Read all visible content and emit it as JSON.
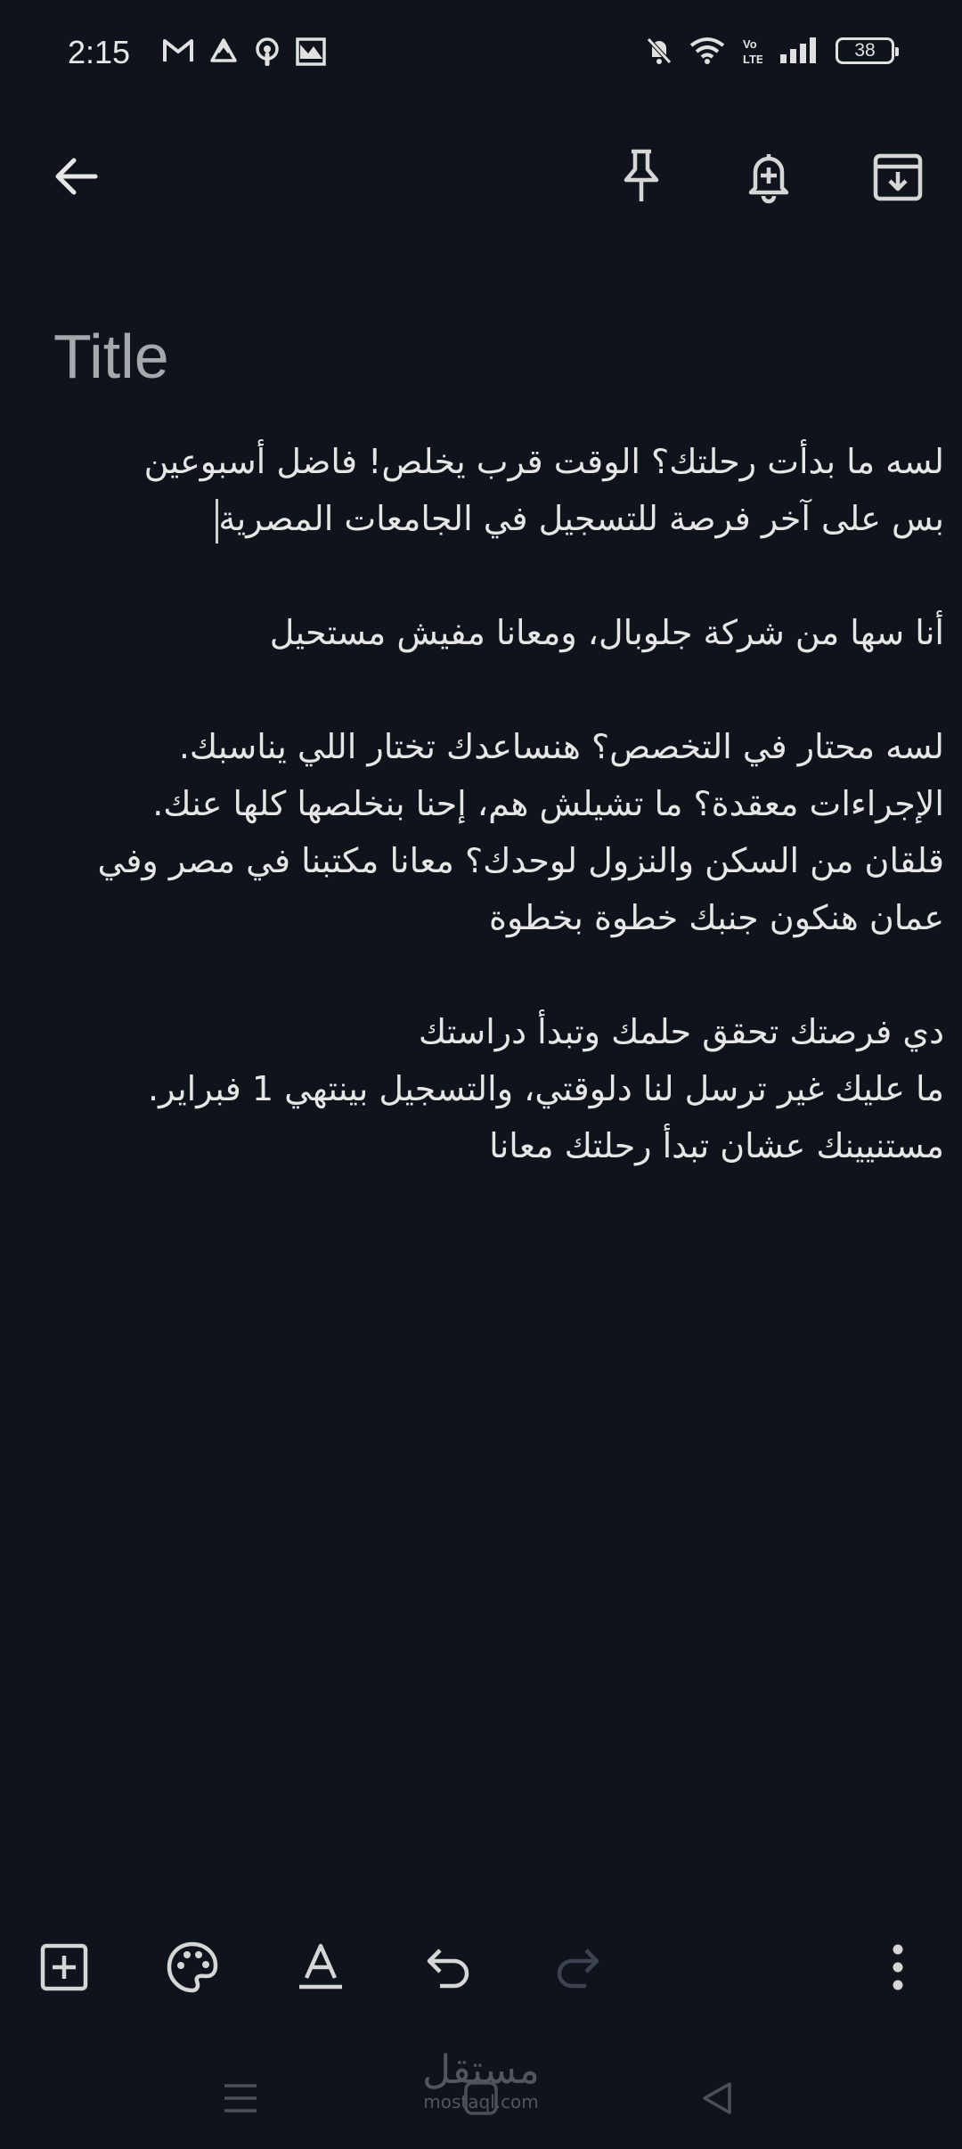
{
  "status_bar": {
    "time": "2:15",
    "battery": "38"
  },
  "note": {
    "title_placeholder": "Title",
    "lines": [
      "لسه ما بدأت رحلتك؟ الوقت قرب يخلص! فاضل أسبوعين",
      "بس على آخر فرصة للتسجيل في الجامعات المصرية",
      "",
      "أنا سها من شركة جلوبال، ومعانا مفيش مستحيل",
      "",
      "لسه محتار في التخصص؟ هنساعدك تختار اللي يناسبك.",
      "الإجراءات معقدة؟ ما تشيلش هم، إحنا بنخلصها كلها عنك.",
      "قلقان من السكن والنزول لوحدك؟ معانا مكتبنا في مصر وفي",
      "عمان هنكون جنبك خطوة بخطوة",
      "",
      "دي فرصتك تحقق حلمك وتبدأ دراستك",
      "ما عليك غير ترسل لنا دلوقتي، والتسجيل بينتهي 1 فبراير.",
      "مستنيينك عشان تبدأ رحلتك معانا"
    ]
  },
  "watermark": {
    "arabic": "مستقل",
    "latin": "mostaql.com"
  },
  "icons": {
    "back": "arrow-left-icon",
    "pin": "pin-icon",
    "reminder": "bell-plus-icon",
    "archive": "archive-icon",
    "add": "add-box-icon",
    "palette": "palette-icon",
    "text_format": "text-format-icon",
    "undo": "undo-icon",
    "redo": "redo-icon",
    "more": "more-vert-icon"
  }
}
